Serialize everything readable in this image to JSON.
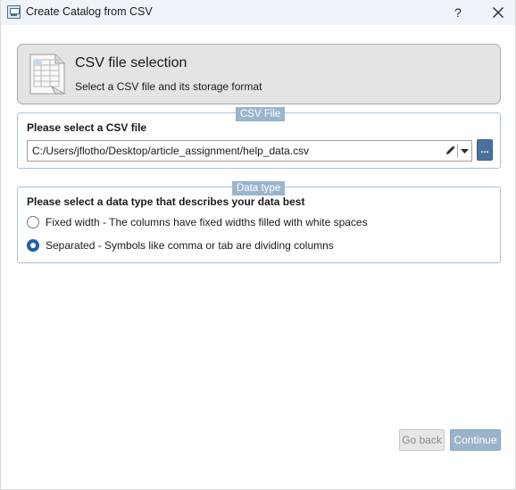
{
  "window": {
    "title": "Create Catalog from CSV",
    "help_label": "?"
  },
  "header": {
    "title": "CSV file selection",
    "subtitle": "Select a CSV file and its storage format"
  },
  "csv_file_group": {
    "tag": "CSV File",
    "heading": "Please select a CSV file",
    "path_value": "C:/Users/jflotho/Desktop/article_assignment/help_data.csv",
    "browse_label": "..."
  },
  "data_type_group": {
    "tag": "Data type",
    "heading": "Please select a data type that describes your data best",
    "options": [
      {
        "label": "Fixed width - The columns have fixed widths filled with white spaces",
        "selected": false
      },
      {
        "label": "Separated - Symbols like comma or tab are dividing columns",
        "selected": true
      }
    ]
  },
  "footer": {
    "back_label": "Go back",
    "continue_label": "Continue"
  },
  "colors": {
    "accent": "#1f5fa8",
    "group_tag": "#9ab4cc",
    "group_border": "#a9c2d8",
    "titlebar_bg": "#eef4fa",
    "header_panel_bg": "#e4e4e4",
    "browse_button": "#4a7199"
  },
  "icons": {
    "app": "catalog-app-icon",
    "header": "spreadsheet-icon",
    "edit": "pencil-icon",
    "dropdown": "chevron-down-icon",
    "close": "close-icon"
  }
}
